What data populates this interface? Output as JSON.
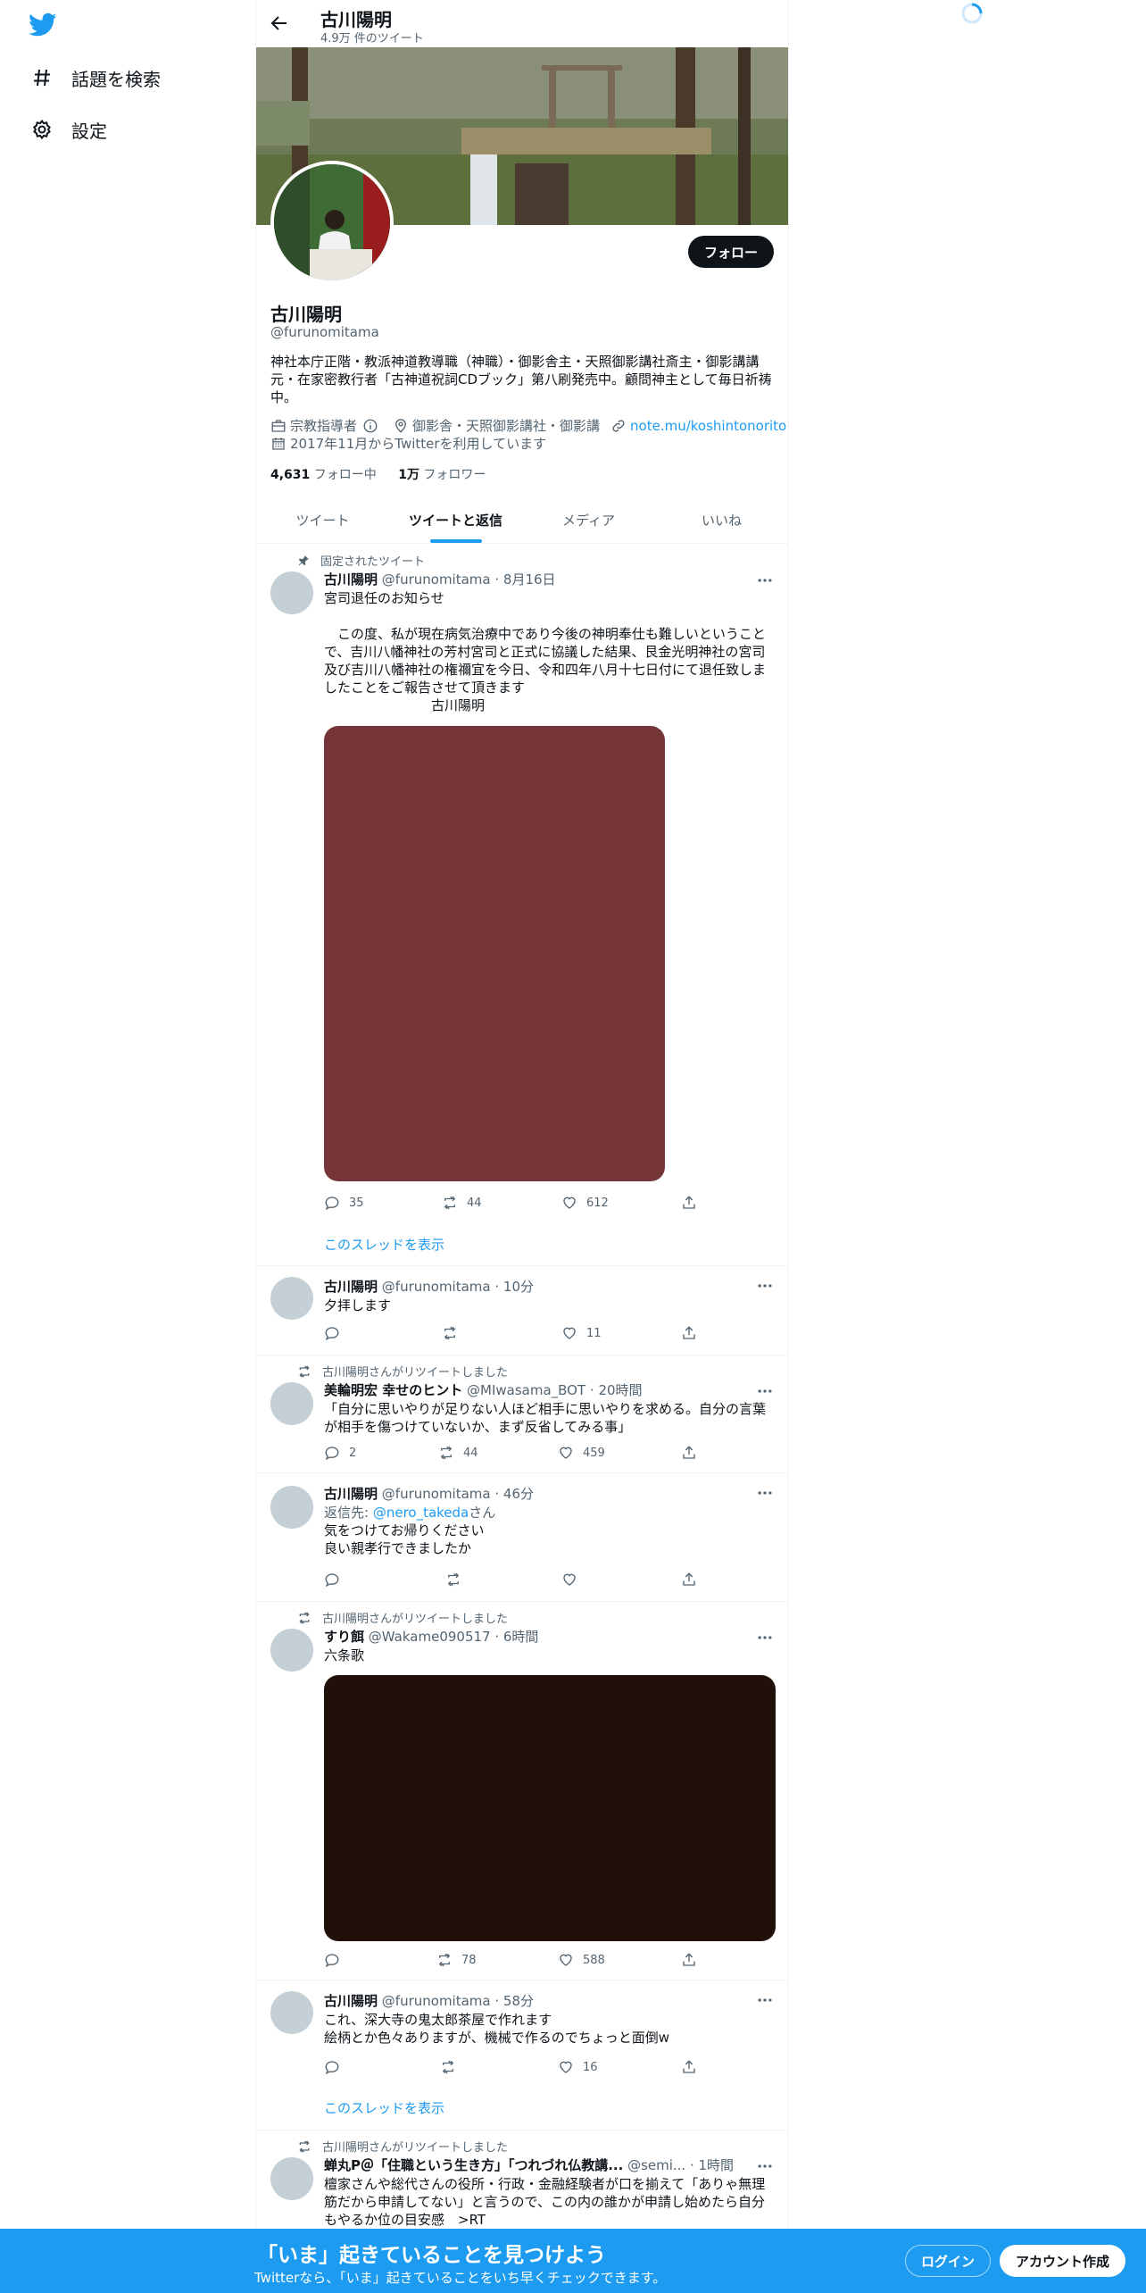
{
  "nav": {
    "logo_icon": "twitter-bird-icon",
    "items": [
      {
        "label": "話題を検索",
        "icon": "hashtag-icon"
      },
      {
        "label": "設定",
        "icon": "gear-icon"
      }
    ]
  },
  "header": {
    "name": "古川陽明",
    "tweet_count": "4.9万 件のツイート"
  },
  "profile": {
    "follow_label": "フォロー",
    "name": "古川陽明",
    "handle": "@furunomitama",
    "bio": "神社本庁正階・教派神道教導職（神職）・御影舎主・天照御影講社斎主・御影講講元・在家密教行者「古神道祝詞CDブック」第八刷発売中。顧問神主として毎日祈祷中。",
    "category": "宗教指導者",
    "location": "御影舎・天照御影講社・御影講",
    "link": "note.mu/koshintonorito",
    "joined": "2017年11月からTwitterを利用しています",
    "following_count": "4,631",
    "following_label": "フォロー中",
    "followers_count": "1万",
    "followers_label": "フォロワー"
  },
  "tabs": [
    {
      "label": "ツイート"
    },
    {
      "label": "ツイートと返信",
      "active": true
    },
    {
      "label": "メディア"
    },
    {
      "label": "いいね"
    }
  ],
  "tweets": [
    {
      "context": "固定されたツイート",
      "name": "古川陽明",
      "meta": "@furunomitama · 8月16日",
      "text": "宮司退任のお知らせ\n\n　この度、私が現在病気治療中であり今後の神明奉仕も難しいということで、吉川八幡神社の芳村宮司と正式に協議した結果、艮金光明神社の宮司及び吉川八幡神社の権禰宜を今日、令和四年八月十七日付にて退任致しましたことをご報告させて頂きます\n　　　　　　　　古川陽明",
      "reply": "35",
      "retweet": "44",
      "like": "612",
      "thread_link": "このスレッドを表示",
      "media_color": "#763538"
    },
    {
      "name": "古川陽明",
      "meta": "@furunomitama · 10分",
      "text": "夕拝します",
      "reply": "",
      "retweet": "",
      "like": "11"
    },
    {
      "context": "古川陽明さんがリツイートしました",
      "name": "美輪明宏 幸せのヒント",
      "meta": "@MIwasama_BOT · 20時間",
      "text": "「自分に思いやりが足りない人ほど相手に思いやりを求める。自分の言葉が相手を傷つけていないか、まず反省してみる事」",
      "reply": "2",
      "retweet": "44",
      "like": "459"
    },
    {
      "name": "古川陽明",
      "meta": "@furunomitama · 46分",
      "reply_to_label": "返信先: ",
      "reply_to_handle": "@nero_takeda",
      "reply_to_suffix": "さん",
      "text": "気をつけてお帰りください\n良い親孝行できましたか",
      "reply": "",
      "retweet": "",
      "like": ""
    },
    {
      "context": "古川陽明さんがリツイートしました",
      "name": "すり餌",
      "meta": "@Wakame090517 · 6時間",
      "text": "六条歌",
      "reply": "",
      "retweet": "78",
      "like": "588",
      "media_color": "#211009"
    },
    {
      "name": "古川陽明",
      "meta": "@furunomitama · 58分",
      "text": "これ、深大寺の鬼太郎茶屋で作れます\n絵柄とか色々ありますが、機械で作るのでちょっと面倒w",
      "reply": "",
      "retweet": "",
      "like": "16",
      "thread_link": "このスレッドを表示"
    },
    {
      "context": "古川陽明さんがリツイートしました",
      "name": "蝉丸P＠「住職という生き方」「つれづれ仏教講...",
      "meta": "@semi... · 1時間",
      "text": "檀家さんや総代さんの役所・行政・金融経験者が口を揃えて「ありゃ無理筋だから申請してない」と言うので、この内の誰かが申請し始めたら自分もやるか位の目安感　>RT"
    }
  ],
  "bottom": {
    "title": "「いま」起きていることを見つけよう",
    "subtitle": "Twitterなら、「いま」起きていることをいち早くチェックできます。",
    "login": "ログイン",
    "signup": "アカウント作成"
  }
}
